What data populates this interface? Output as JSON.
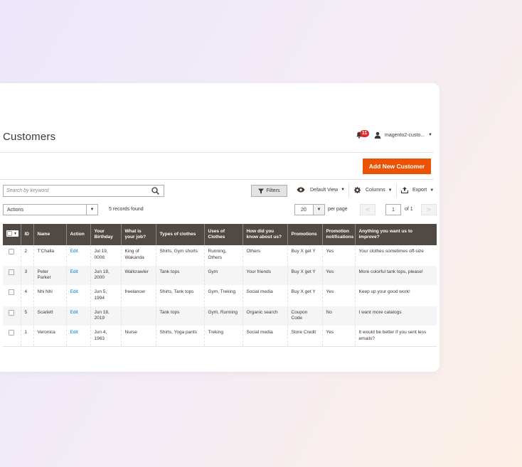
{
  "page": {
    "title": "Customers",
    "notifications_count": "11",
    "user_name": "magento2-custo..."
  },
  "toolbar": {
    "add_button": "Add New Customer",
    "search_placeholder": "Search by keyword",
    "filters_label": "Filters",
    "view_label": "Default View",
    "columns_label": "Columns",
    "export_label": "Export",
    "actions_label": "Actions",
    "records_found": "5 records found",
    "per_page_value": "20",
    "per_page_label": "per page",
    "current_page": "1",
    "page_of": "of 1",
    "prev_symbol": "<",
    "next_symbol": ">"
  },
  "grid": {
    "headers": [
      "ID",
      "Name",
      "Action",
      "Your Birthday",
      "What is your job?",
      "Types of clothes",
      "Uses of Clothes",
      "How did you know about  us?",
      "Promotions",
      "Promotion notifications",
      "Anything you want us to improve?"
    ],
    "rows": [
      {
        "id": "2",
        "name": "T'Challa",
        "action": "Edit",
        "birthday": "Jul 19, 0006",
        "job": "King of Wakanda",
        "types": "Shirts, Gym shorts",
        "uses": "Running, Others",
        "source": "Others",
        "promotions": "Buy X get Y",
        "notifications": "Yes",
        "improve": "Your clothes sometimes off-size"
      },
      {
        "id": "3",
        "name": "Peter Parker",
        "action": "Edit",
        "birthday": "Jun 18, 2000",
        "job": "Wallcrawler",
        "types": "Tank tops",
        "uses": "Gym",
        "source": "Your friends",
        "promotions": "Buy X get Y",
        "notifications": "Yes",
        "improve": "More colorful tank tops, please!"
      },
      {
        "id": "4",
        "name": "Nhi Nhi",
        "action": "Edit",
        "birthday": "Jun 5, 1994",
        "job": "freelancer",
        "types": "Shirts, Tank tops",
        "uses": "Gym, Treking",
        "source": "Social media",
        "promotions": "Buy X get Y",
        "notifications": "Yes",
        "improve": "Keep up your good work!"
      },
      {
        "id": "5",
        "name": "Scarlett",
        "action": "Edit",
        "birthday": "Jun 18, 2019",
        "job": "",
        "types": "Tank tops",
        "uses": "Gym, Running",
        "source": "Organic search",
        "promotions": "Coupon Code",
        "notifications": "No",
        "improve": "I want more catalogs"
      },
      {
        "id": "1",
        "name": "Veronica",
        "action": "Edit",
        "birthday": "Jun 4, 1963",
        "job": "Nurse",
        "types": "Shirts,  Yoga  pants",
        "uses": "Treking",
        "source": "Social media",
        "promotions": "Store Credit",
        "notifications": "Yes",
        "improve": "It would be better if you sent less emails?"
      }
    ]
  },
  "colors": {
    "accent": "#eb5202",
    "header_bg": "#514943",
    "link": "#007bdb",
    "badge": "#e22626"
  }
}
